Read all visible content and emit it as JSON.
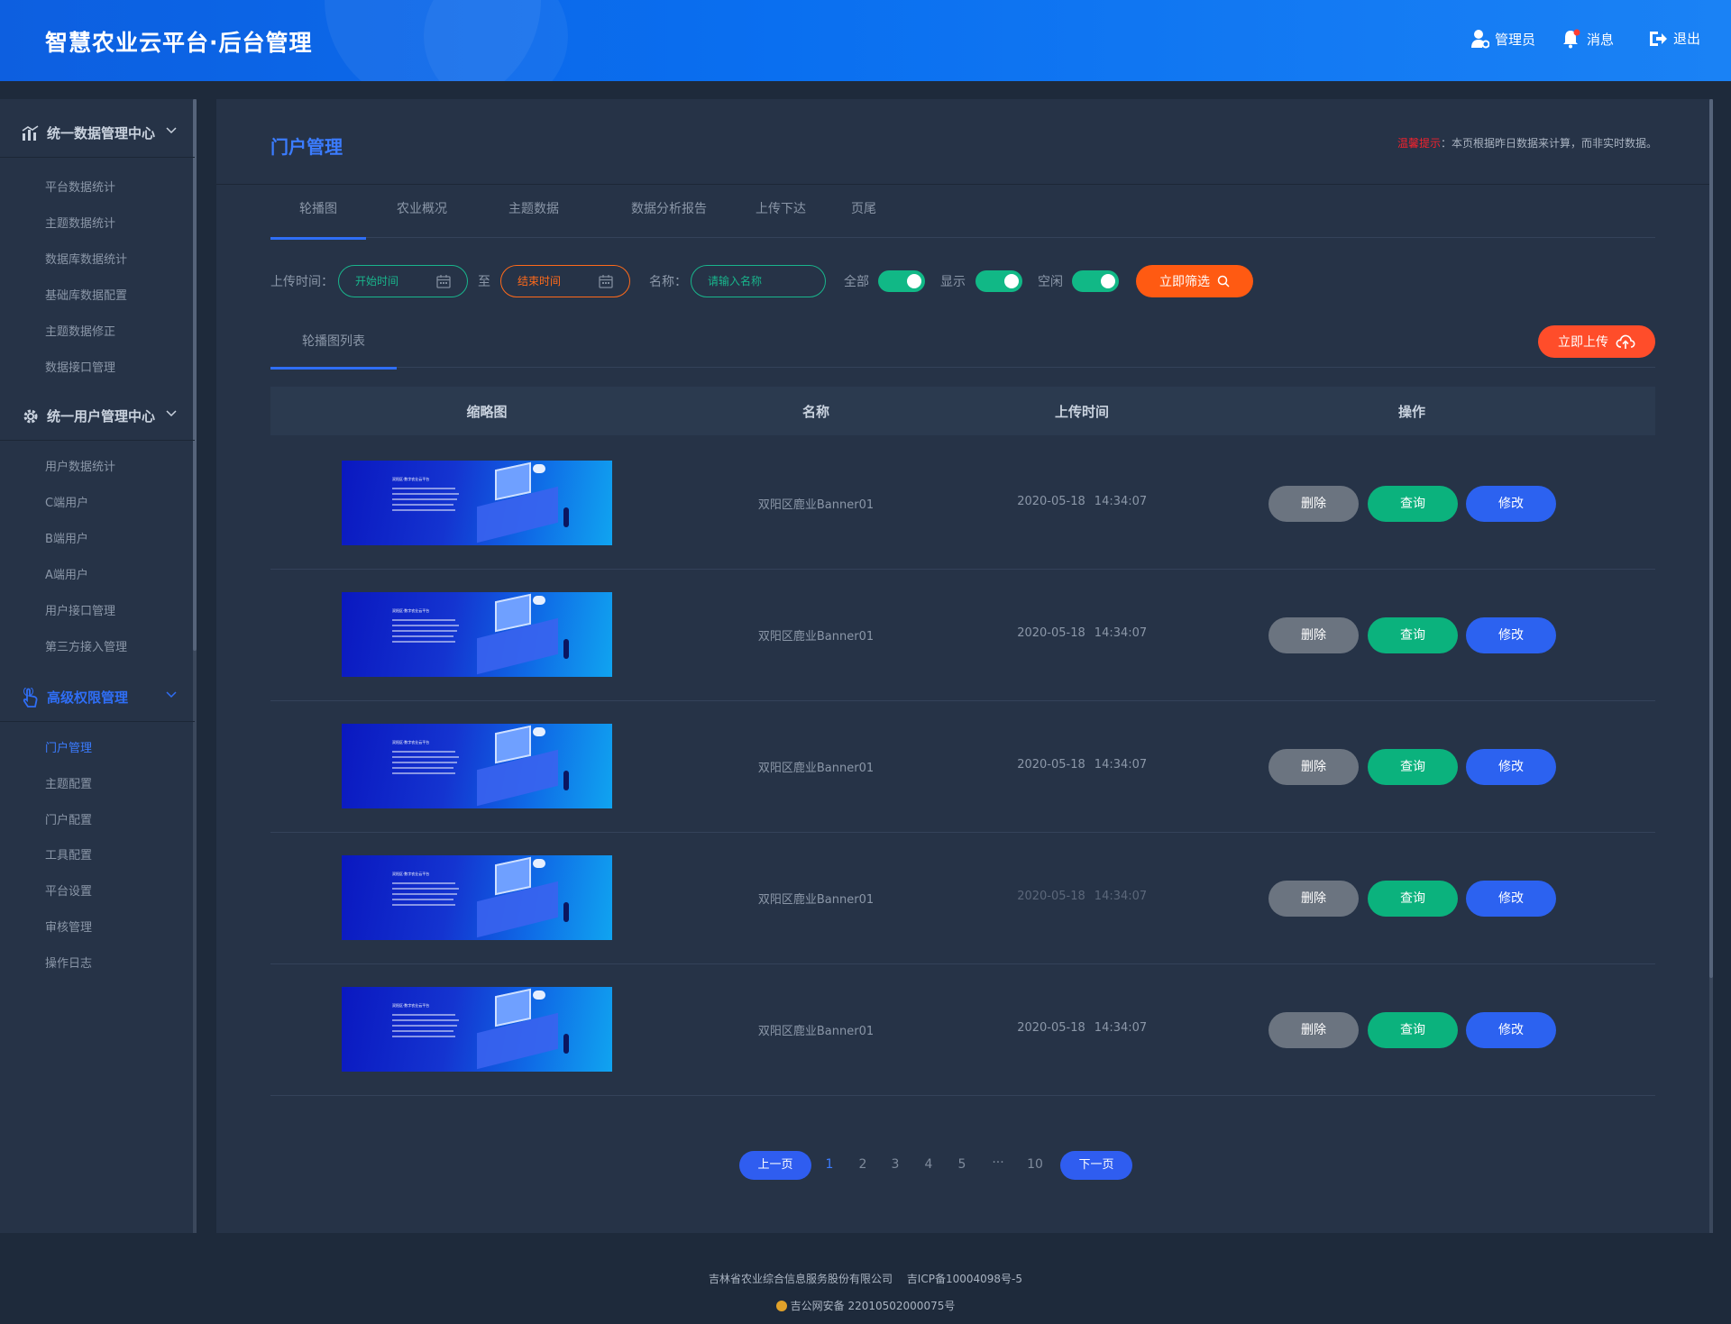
{
  "header": {
    "title": "智慧农业云平台·后台管理",
    "admin_label": "管理员",
    "message_label": "消息",
    "logout_label": "退出"
  },
  "sidebar": {
    "sections": [
      {
        "title": "统一数据管理中心",
        "icon": "chart-icon",
        "items": [
          "平台数据统计",
          "主题数据统计",
          "数据库数据统计",
          "基础库数据配置",
          "主题数据修正",
          "数据接口管理"
        ]
      },
      {
        "title": "统一用户管理中心",
        "icon": "gear-icon",
        "items": [
          "用户数据统计",
          "C端用户",
          "B端用户",
          "A端用户",
          "用户接口管理",
          "第三方接入管理"
        ]
      },
      {
        "title": "高级权限管理",
        "icon": "hand-pointer-icon",
        "items": [
          "门户管理",
          "主题配置",
          "门户配置",
          "工具配置",
          "平台设置",
          "审核管理",
          "操作日志"
        ]
      }
    ],
    "active_item": "门户管理"
  },
  "main": {
    "page_title": "门户管理",
    "notice_prefix": "温馨提示",
    "notice_text": "：本页根据昨日数据来计算，而非实时数据。",
    "tabs": [
      "轮播图",
      "农业概况",
      "主题数据",
      "数据分析报告",
      "上传下达",
      "页尾"
    ],
    "active_tab": "轮播图"
  },
  "filter": {
    "upload_time_label": "上传时间：",
    "start_placeholder": "开始时间",
    "to_label": "至",
    "end_placeholder": "结束时间",
    "name_label": "名称：",
    "name_placeholder": "请输入名称",
    "toggles": [
      {
        "label": "全部",
        "on": true
      },
      {
        "label": "显示",
        "on": true
      },
      {
        "label": "空闲",
        "on": true
      }
    ],
    "filter_button": "立即筛选"
  },
  "list": {
    "subtab": "轮播图列表",
    "upload_button": "立即上传",
    "columns": [
      "缩略图",
      "名称",
      "上传时间",
      "操作"
    ],
    "banner_caption": "双阳区·数字农业云平台",
    "rows": [
      {
        "name": "双阳区鹿业Banner01",
        "date": "2020-05-18",
        "time": "14:34:07"
      },
      {
        "name": "双阳区鹿业Banner01",
        "date": "2020-05-18",
        "time": "14:34:07"
      },
      {
        "name": "双阳区鹿业Banner01",
        "date": "2020-05-18",
        "time": "14:34:07"
      },
      {
        "name": "双阳区鹿业Banner01",
        "date": "2020-05-18",
        "time": "14:34:07"
      },
      {
        "name": "双阳区鹿业Banner01",
        "date": "2020-05-18",
        "time": "14:34:07"
      }
    ],
    "actions": {
      "delete": "删除",
      "query": "查询",
      "edit": "修改"
    }
  },
  "pagination": {
    "prev": "上一页",
    "next": "下一页",
    "pages": [
      "1",
      "2",
      "3",
      "4",
      "5",
      "···",
      "10"
    ],
    "current": "1"
  },
  "footer": {
    "line1": "吉林省农业综合信息服务股份有限公司　 吉ICP备10004098号-5",
    "line2": "吉公网安备 22010502000075号"
  },
  "colors": {
    "accent": "#2f6ef5",
    "green": "#0bb27d",
    "orange": "#ff5a12",
    "gray": "#6b7480"
  }
}
